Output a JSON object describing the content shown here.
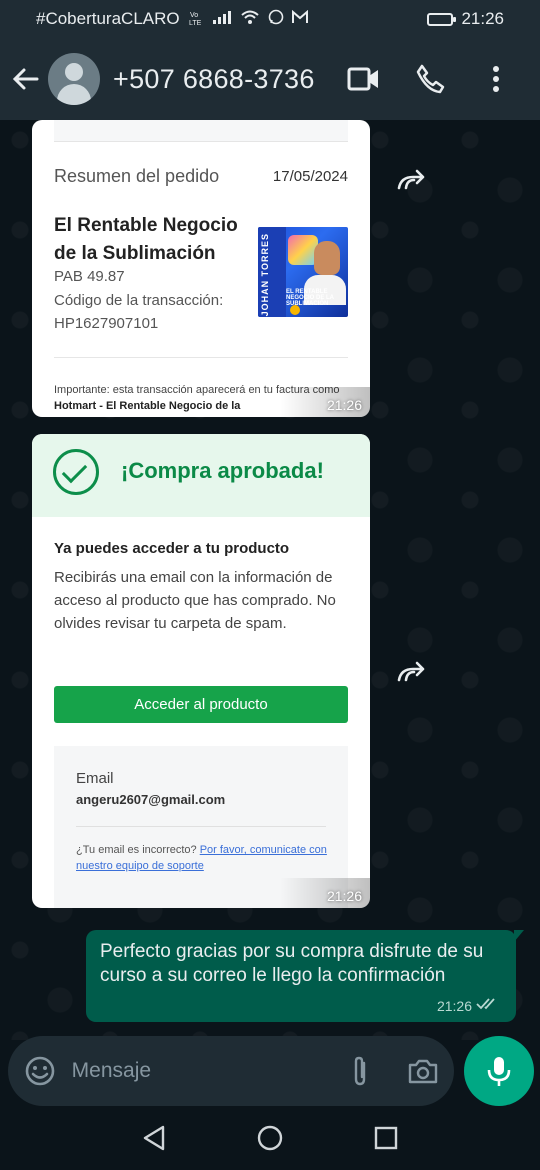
{
  "status_bar": {
    "carrier": "#CoberturaCLARO",
    "volte": "Vo LTE",
    "time": "21:26"
  },
  "header": {
    "contact": "+507 6868-3736",
    "icons": [
      "back-arrow-icon",
      "avatar",
      "video-call-icon",
      "phone-icon",
      "more-vert-icon"
    ]
  },
  "messages": {
    "card1": {
      "summary": "Resumen del pedido",
      "date": "17/05/2024",
      "product_title": "El Rentable Negocio de la Sublimación",
      "price": "PAB 49.87",
      "code_label": "Código de la transacción:",
      "code": "HP1627907101",
      "thumb_text": "JOHAN TORRES",
      "thumb_caption": "EL RENTABLE NEGOCIO DE LA SUBLIMACIÓN",
      "note_prefix": "Importante: esta transacción aparecerá en tu factura como",
      "note_bold": "Hotmart - El Rentable Negocio de la",
      "time": "21:26"
    },
    "card2": {
      "approved": "¡Compra aprobada!",
      "access_title": "Ya puedes acceder a tu producto",
      "body": "Recibirás una email con la información de acceso al producto que has comprado. No olvides revisar tu carpeta de spam.",
      "button": "Acceder al producto",
      "email_label": "Email",
      "email": "angeru2607@gmail.com",
      "wrong_prefix": "¿Tu email es incorrecto?",
      "wrong_link": "Por favor, comunicate con nuestro equipo de soporte",
      "time": "21:26"
    },
    "outgoing": {
      "text": "Perfecto gracias por su compra disfrute de su curso a su correo le llego la confirmación",
      "time": "21:26",
      "status": "read"
    }
  },
  "composer": {
    "placeholder": "Mensaje"
  },
  "colors": {
    "header_bg": "#1f2c34",
    "chat_bg": "#0b141a",
    "outgoing_bubble": "#005c4b",
    "mic_button": "#00a884",
    "approved_green": "#0b8a47",
    "cta_green": "#16a34a"
  }
}
